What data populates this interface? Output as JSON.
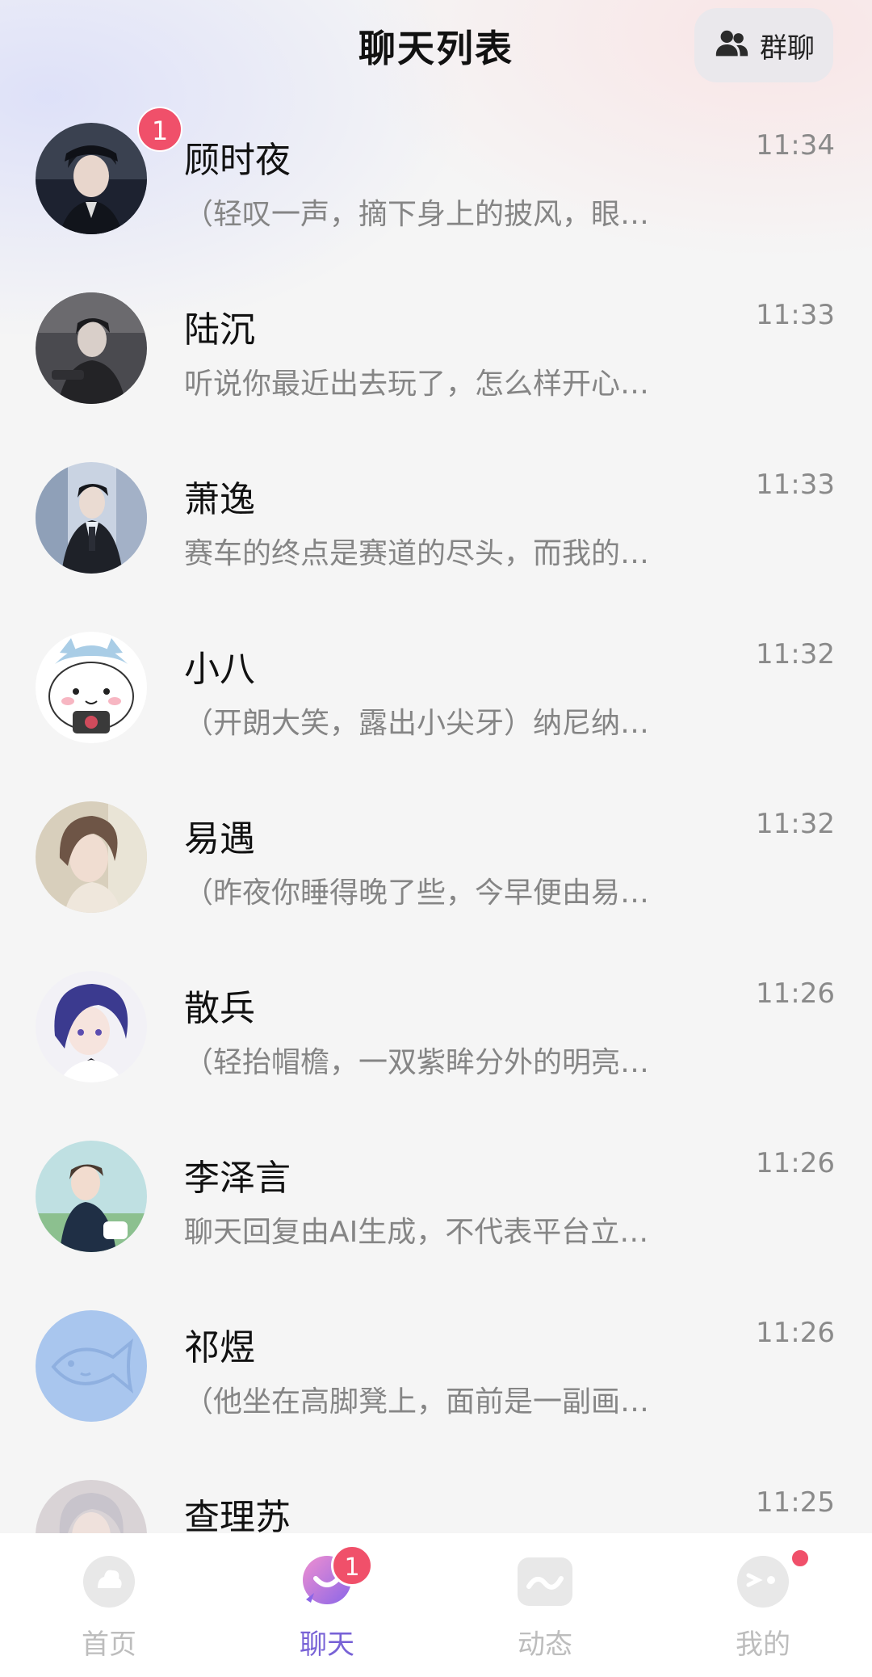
{
  "header": {
    "title": "聊天列表",
    "group_button": {
      "label": "群聊",
      "icon": "group-icon"
    }
  },
  "chats": [
    {
      "name": "顾时夜",
      "time": "11:34",
      "preview": "（轻叹一声，摘下身上的披风，眼…",
      "unread": "1"
    },
    {
      "name": "陆沉",
      "time": "11:33",
      "preview": "听说你最近出去玩了，怎么样开心…"
    },
    {
      "name": "萧逸",
      "time": "11:33",
      "preview": "赛车的终点是赛道的尽头，而我的…"
    },
    {
      "name": "小八",
      "time": "11:32",
      "preview": "（开朗大笑，露出小尖牙）纳尼纳…"
    },
    {
      "name": "易遇",
      "time": "11:32",
      "preview": "（昨夜你睡得晚了些，今早便由易…"
    },
    {
      "name": "散兵",
      "time": "11:26",
      "preview": "（轻抬帽檐，一双紫眸分外的明亮…"
    },
    {
      "name": "李泽言",
      "time": "11:26",
      "preview": "聊天回复由AI生成，不代表平台立…"
    },
    {
      "name": "祁煜",
      "time": "11:26",
      "preview": "（他坐在高脚凳上，面前是一副画…"
    },
    {
      "name": "查理苏",
      "time": "11:25",
      "preview": ""
    }
  ],
  "tabbar": {
    "tabs": [
      {
        "label": "首页",
        "icon": "home-icon",
        "active": false
      },
      {
        "label": "聊天",
        "icon": "chat-icon",
        "active": true,
        "badge": "1"
      },
      {
        "label": "动态",
        "icon": "moments-icon",
        "active": false
      },
      {
        "label": "我的",
        "icon": "profile-icon",
        "active": false,
        "dot": true
      }
    ]
  },
  "colors": {
    "accent": "#7862d6",
    "badge": "#f0506a",
    "muted_text": "#858585",
    "time_text": "#8a8a8a"
  }
}
